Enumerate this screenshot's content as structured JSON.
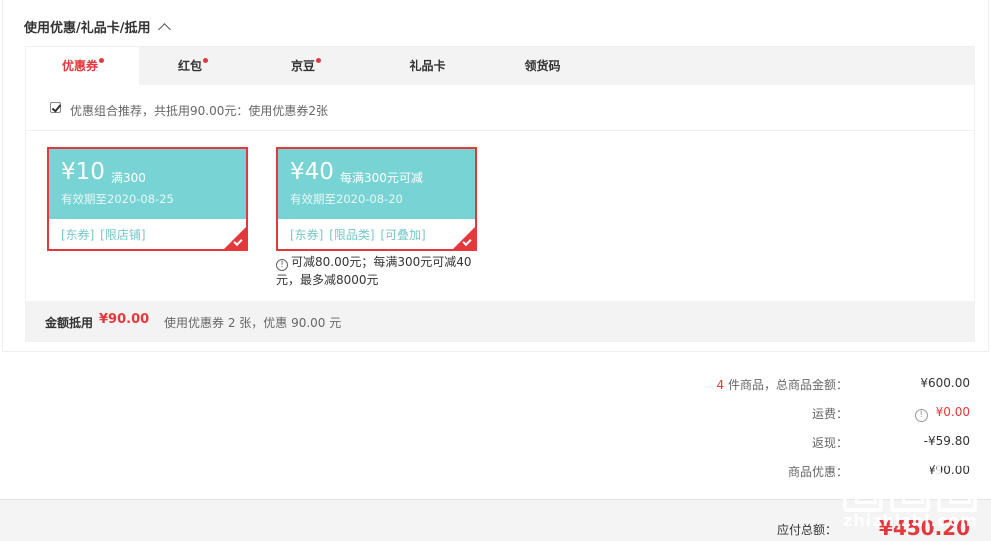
{
  "section": {
    "title": "使用优惠/礼品卡/抵用"
  },
  "tabs": [
    {
      "label": "优惠券",
      "dot": true,
      "active": true
    },
    {
      "label": "红包",
      "dot": true,
      "active": false
    },
    {
      "label": "京豆",
      "dot": true,
      "active": false
    },
    {
      "label": "礼品卡",
      "dot": false,
      "active": false
    },
    {
      "label": "领货码",
      "dot": false,
      "active": false
    }
  ],
  "combo": {
    "checked": true,
    "text": "优惠组合推荐，共抵用90.00元：使用优惠券2张"
  },
  "coupons": [
    {
      "amount": "¥10",
      "condition": "满300",
      "valid": "有效期至2020-08-25",
      "tags": "[东券] [限店铺]",
      "selected": true
    },
    {
      "amount": "¥40",
      "condition": "每满300元可减",
      "valid": "有效期至2020-08-20",
      "tags": "[东券] [限品类] [可叠加]",
      "selected": true
    }
  ],
  "coupon_note": "可减80.00元；每满300元可减40元，最多减8000元",
  "summary": {
    "label": "金额抵用",
    "value": "¥90.00",
    "desc": "使用优惠券 2 张，优惠 90.00 元"
  },
  "totals": {
    "count": "4",
    "goods_label": " 件商品，总商品金额：",
    "goods_value": "¥600.00",
    "shipping_label": "运费：",
    "shipping_value": "¥0.00",
    "cashback_label": "返现：",
    "cashback_value": "-¥59.80",
    "discount_label": "商品优惠：",
    "discount_value": "¥90.00"
  },
  "pay": {
    "label": "应付总额：",
    "value": "¥450.20"
  },
  "watermark": {
    "site": "zhizhizhi.com"
  },
  "colors": {
    "accent": "#e4393c",
    "coupon_bg": "#78d4d4"
  }
}
